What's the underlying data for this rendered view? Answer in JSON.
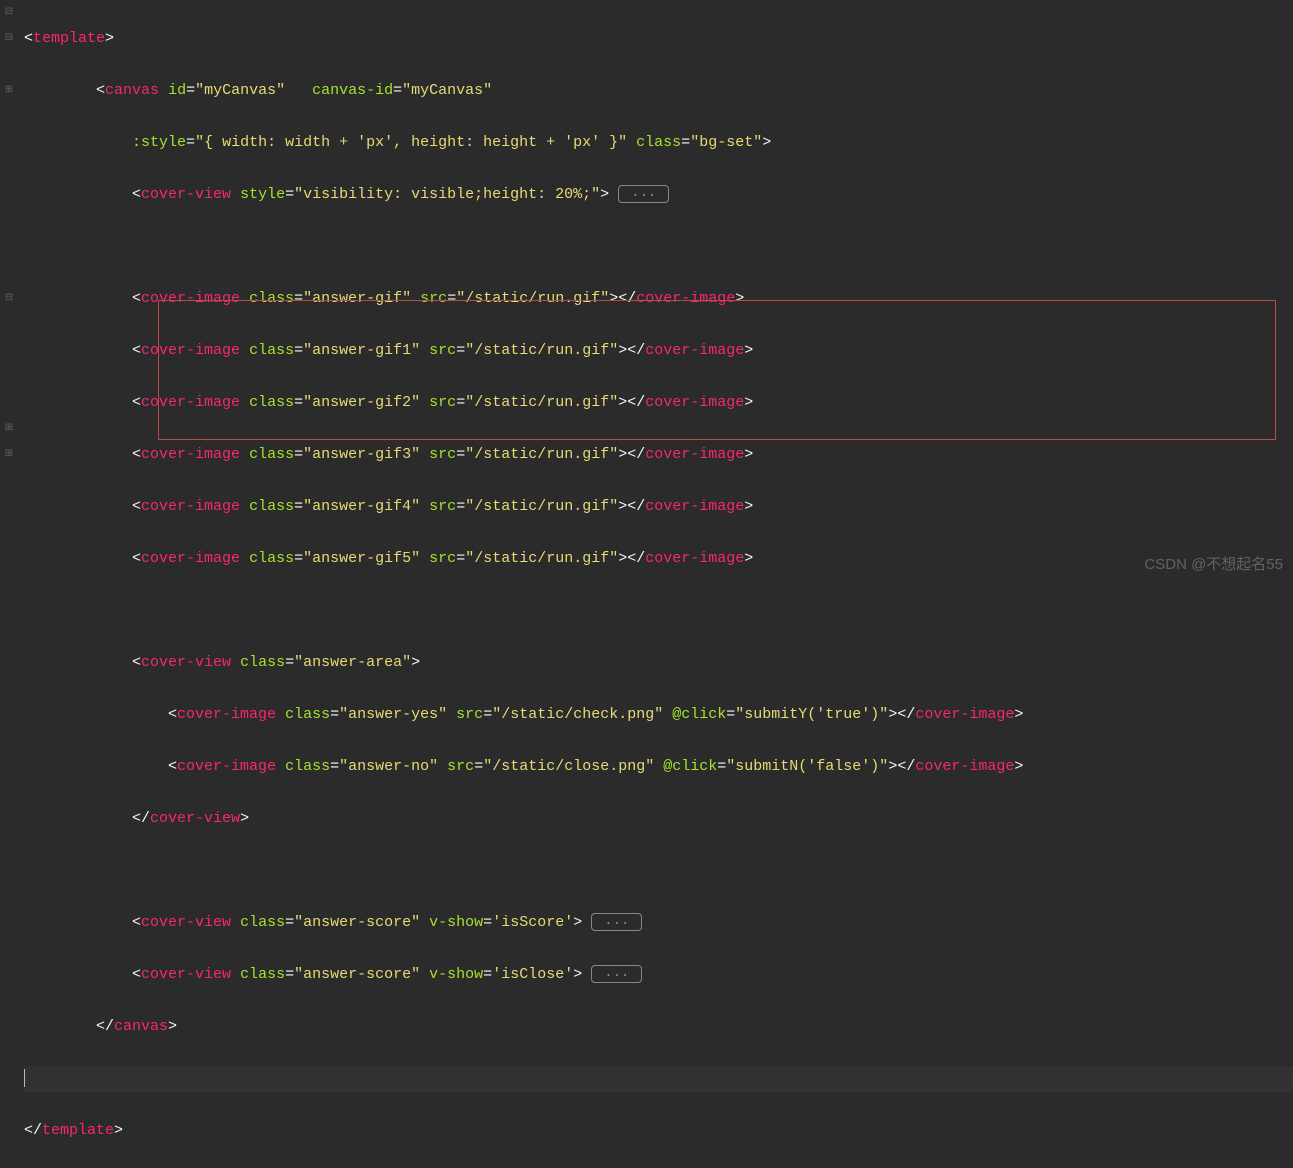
{
  "gutter": [
    "⊟",
    "⊟",
    "",
    "⊞",
    "",
    "",
    "",
    "",
    "",
    "",
    "",
    "⊟",
    "",
    "",
    "",
    "",
    "⊞",
    "⊞",
    "",
    "",
    ""
  ],
  "lines": {
    "l1": {
      "open": "<",
      "tag": "template",
      "close": ">"
    },
    "l2": {
      "open": "<",
      "tag": "canvas",
      "a1n": "id",
      "a1v": "\"myCanvas\"",
      "a2n": "canvas-id",
      "a2v": "\"myCanvas\""
    },
    "l3": {
      "a1n": ":style",
      "a1v": "\"{ width: width + 'px', height: height + 'px' }\"",
      "a2n": "class",
      "a2v": "\"bg-set\"",
      "close": ">"
    },
    "l4": {
      "open": "<",
      "tag": "cover-view",
      "a1n": "style",
      "a1v": "\"visibility: visible;height: 20%;\"",
      "close": ">",
      "collapsed": "..."
    },
    "l5": {
      "open": "<",
      "tag": "cover-image",
      "a1n": "class",
      "a1v": "\"answer-gif\"",
      "a2n": "src",
      "a2v": "\"/static/run.gif\"",
      "close": ">",
      "ctag": "cover-image"
    },
    "l6": {
      "open": "<",
      "tag": "cover-image",
      "a1n": "class",
      "a1v": "\"answer-gif1\"",
      "a2n": "src",
      "a2v": "\"/static/run.gif\"",
      "close": ">",
      "ctag": "cover-image"
    },
    "l7": {
      "open": "<",
      "tag": "cover-image",
      "a1n": "class",
      "a1v": "\"answer-gif2\"",
      "a2n": "src",
      "a2v": "\"/static/run.gif\"",
      "close": ">",
      "ctag": "cover-image"
    },
    "l8": {
      "open": "<",
      "tag": "cover-image",
      "a1n": "class",
      "a1v": "\"answer-gif3\"",
      "a2n": "src",
      "a2v": "\"/static/run.gif\"",
      "close": ">",
      "ctag": "cover-image"
    },
    "l9": {
      "open": "<",
      "tag": "cover-image",
      "a1n": "class",
      "a1v": "\"answer-gif4\"",
      "a2n": "src",
      "a2v": "\"/static/run.gif\"",
      "close": ">",
      "ctag": "cover-image"
    },
    "l10": {
      "open": "<",
      "tag": "cover-image",
      "a1n": "class",
      "a1v": "\"answer-gif5\"",
      "a2n": "src",
      "a2v": "\"/static/run.gif\"",
      "close": ">",
      "ctag": "cover-image"
    },
    "l11": {
      "open": "<",
      "tag": "cover-view",
      "a1n": "class",
      "a1v": "\"answer-area\"",
      "close": ">"
    },
    "l12": {
      "open": "<",
      "tag": "cover-image",
      "a1n": "class",
      "a1v": "\"answer-yes\"",
      "a2n": "src",
      "a2v": "\"/static/check.png\"",
      "a3n": "@click",
      "a3v": "\"submitY('true')\"",
      "close": ">",
      "ctag": "cover-image"
    },
    "l13": {
      "open": "<",
      "tag": "cover-image",
      "a1n": "class",
      "a1v": "\"answer-no\"",
      "a2n": "src",
      "a2v": "\"/static/close.png\"",
      "a3n": "@click",
      "a3v": "\"submitN('false')\"",
      "close": ">",
      "ctag": "cover-image"
    },
    "l14": {
      "open": "</",
      "tag": "cover-view",
      "close": ">"
    },
    "l15": {
      "open": "<",
      "tag": "cover-view",
      "a1n": "class",
      "a1v": "\"answer-score\"",
      "a2n": "v-show",
      "a2v": "'isScore'",
      "close": ">",
      "collapsed": "..."
    },
    "l16": {
      "open": "<",
      "tag": "cover-view",
      "a1n": "class",
      "a1v": "\"answer-score\"",
      "a2n": "v-show",
      "a2v": "'isClose'",
      "close": ">",
      "collapsed": "..."
    },
    "l17": {
      "open": "</",
      "tag": "canvas",
      "close": ">"
    },
    "l18": {
      "open": "</",
      "tag": "template",
      "close": ">"
    }
  },
  "watermark": "CSDN @不想起名55"
}
